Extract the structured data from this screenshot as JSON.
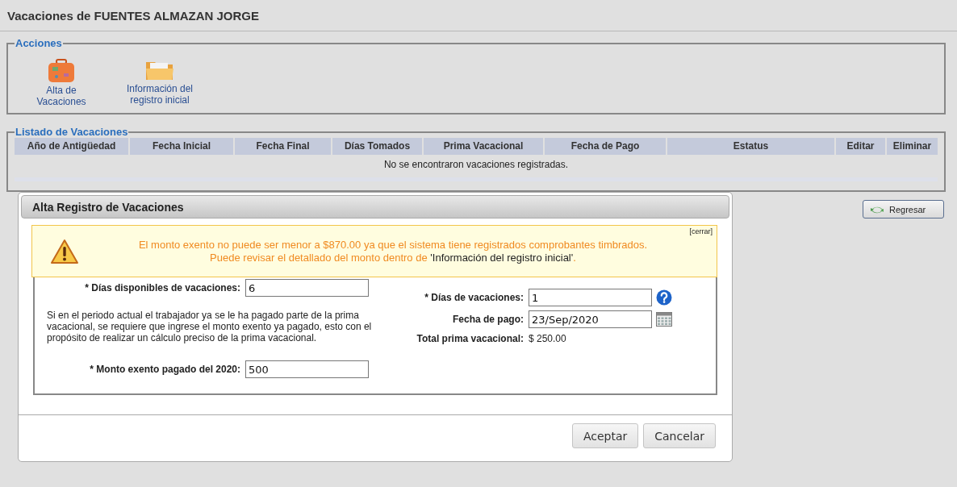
{
  "page_title": "Vacaciones de FUENTES ALMAZAN JORGE",
  "actions": {
    "legend": "Acciones",
    "items": [
      {
        "kind": "suitcase",
        "label": "Alta de Vacaciones"
      },
      {
        "kind": "folder",
        "label": "Información del registro inicial"
      }
    ]
  },
  "list": {
    "legend": "Listado de Vacaciones",
    "columns": [
      "Año de Antigüedad",
      "Fecha Inicial",
      "Fecha Final",
      "Días Tomados",
      "Prima Vacacional",
      "Fecha de Pago",
      "Estatus",
      "Editar",
      "Eliminar"
    ],
    "empty_message": "No se encontraron vacaciones registradas."
  },
  "back_button": "Regresar",
  "dialog": {
    "title": "Alta Registro de Vacaciones",
    "alert": {
      "close": "[cerrar]",
      "message": "El monto exento no puede ser menor a $870.00 ya que el sistema tiene registrados comprobantes timbrados.",
      "hint": "Puede revisar el detallado del monto dentro de",
      "link": "'Información del registro inicial'",
      "end": "."
    },
    "left_fields": [
      {
        "kind": "input",
        "label": "* Días disponibles de vacaciones:",
        "value": "6"
      },
      {
        "kind": "note",
        "text": "Si en el periodo actual el trabajador ya se le ha pagado parte de la prima vacacional, se requiere que ingrese el monto exento ya pagado, esto con el propósito de realizar un cálculo preciso de la prima vacacional."
      },
      {
        "kind": "input",
        "label": "* Monto exento pagado del 2020:",
        "value": "500"
      }
    ],
    "right_fields": [
      {
        "kind": "help",
        "label": "* Días de vacaciones:",
        "value": "1"
      },
      {
        "kind": "date",
        "label": "Fecha de pago:",
        "value": "23/Sep/2020"
      },
      {
        "kind": "total",
        "label": "Total prima vacacional:",
        "value": "$ 250.00"
      }
    ],
    "buttons": [
      "Aceptar",
      "Cancelar"
    ]
  }
}
